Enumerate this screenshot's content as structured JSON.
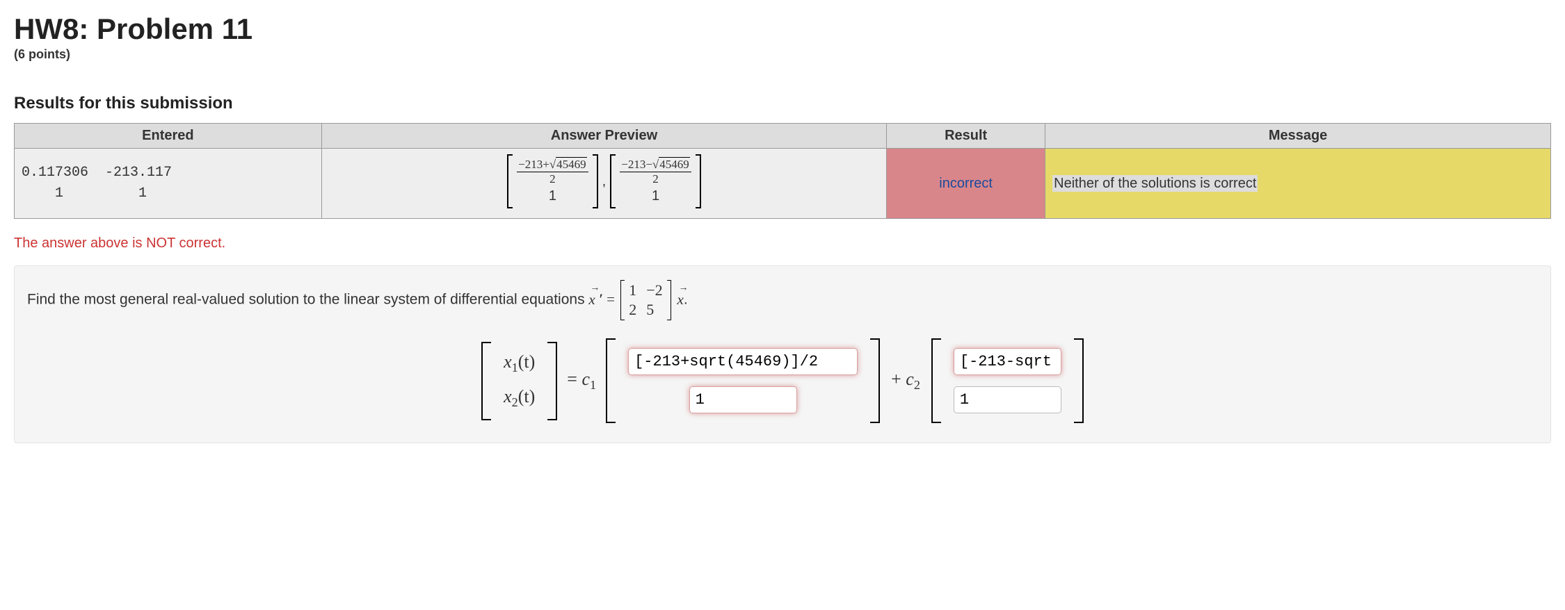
{
  "title": "HW8: Problem 11",
  "points": "(6 points)",
  "results_heading": "Results for this submission",
  "table": {
    "headers": {
      "entered": "Entered",
      "preview": "Answer Preview",
      "result": "Result",
      "message": "Message"
    },
    "row": {
      "entered": "0.117306  -213.117\n    1         1",
      "preview": {
        "v1_top_sign": "−213+",
        "v1_top_rad": "45469",
        "v1_den": "2",
        "v1_bot": "1",
        "comma": ",",
        "v2_top_sign": "−213−",
        "v2_top_rad": "45469",
        "v2_den": "2",
        "v2_bot": "1"
      },
      "result": "incorrect",
      "message": "Neither of the solutions is correct"
    }
  },
  "not_correct": "The answer above is NOT correct.",
  "prompt": {
    "text_before": "Find the most general real-valued solution to the linear system of differential equations ",
    "matrix": {
      "a11": "1",
      "a12": "−2",
      "a21": "2",
      "a22": "5"
    },
    "text_after": "."
  },
  "answer_form": {
    "lhs": {
      "x1": "x",
      "x1sub": "1",
      "x2": "x",
      "x2sub": "2",
      "arg": "(t)"
    },
    "equals": "=",
    "c1_label": "c",
    "c1_sub": "1",
    "plus": "+",
    "c2_label": "c",
    "c2_sub": "2",
    "inputs": {
      "a11": "[-213+sqrt(45469)]/2",
      "a21": "1",
      "b11": "[-213-sqrt",
      "b21": "1"
    }
  }
}
